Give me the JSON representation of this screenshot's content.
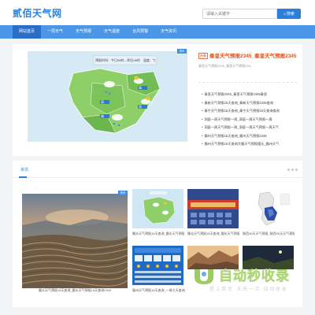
{
  "site": {
    "logo": "贰佰天气网"
  },
  "search": {
    "placeholder": "请输入关键字",
    "button_label": "搜索"
  },
  "nav": {
    "items": [
      {
        "label": "网站首页",
        "active": true
      },
      {
        "label": "一周天气",
        "active": false
      },
      {
        "label": "天气预报",
        "active": false
      },
      {
        "label": "天气温度",
        "active": false
      },
      {
        "label": "台风预警",
        "active": false
      },
      {
        "label": "天气资讯",
        "active": false
      }
    ]
  },
  "hero": {
    "badge": "资讯",
    "map_caption": "预报时间：今日08时—明日08时　温度：℃"
  },
  "featured": {
    "tag": "头条",
    "title": "秦皇天气预报2345_秦皇天气预报2345",
    "desc": "秦皇天气预报2345_秦皇天气预报234..."
  },
  "news_list": [
    "秦皇天气预报2345_秦皇天气预报2345秦皇",
    "秦新天气预报15天查询_秦新天气预报2345查询",
    "秦宁天气预报15天查询_秦宁天气预报15天查询查询",
    "洞庭一周天气预报一周_洞庭一周天气预报一周",
    "洞庭一周天气预报一周_洞庭一周天气预报一周天气",
    "霸州天气预报15天查询_霸州天气预报2345",
    "霸州天气预报15天查询大霸天气预报擂元_霸州天气"
  ],
  "section": {
    "title": "资讯"
  },
  "big_card": {
    "badge": "资讯",
    "caption": "霸水天气预报15天查询_霸水天气预报15天查询2345"
  },
  "tiles": [
    {
      "caption": "霸水天气预报15天查询_霸水天气预报15天查询2345"
    },
    {
      "caption": "隆化天气预报15天查询_隆化天气预报15..."
    },
    {
      "caption": "陕西30天天气预报_陕西30天天气预报..."
    },
    {
      "caption": "赣州天气预报15天查询_一周七天查询_赣..."
    },
    {
      "caption": ""
    },
    {
      "caption": ""
    }
  ],
  "map_labels": [
    "雨",
    "雨",
    "晴",
    "晴"
  ],
  "watermark": {
    "title": "自动秒收录",
    "sub": "登 上 首 页 · 未 来 一 次 · 自 动 收 录"
  },
  "colors": {
    "brand": "#2b7fd9",
    "nav": "#4b96e6",
    "accent": "#e0531c"
  }
}
